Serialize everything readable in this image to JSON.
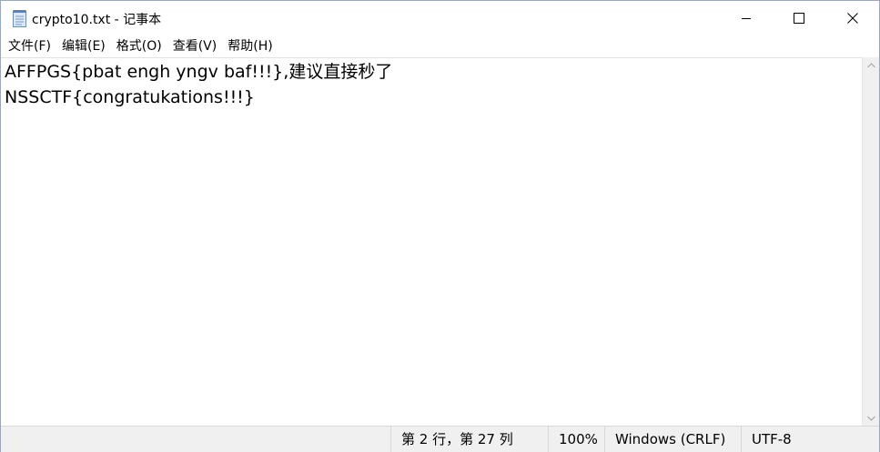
{
  "window": {
    "title": "crypto10.txt - 记事本"
  },
  "menu": {
    "items": [
      {
        "label": "文件(F)"
      },
      {
        "label": "编辑(E)"
      },
      {
        "label": "格式(O)"
      },
      {
        "label": "查看(V)"
      },
      {
        "label": "帮助(H)"
      }
    ]
  },
  "editor": {
    "lines": [
      "AFFPGS{pbat engh yngv baf!!!},建议直接秒了",
      "NSSCTF{congratukations!!!}"
    ]
  },
  "status": {
    "position": "第 2 行，第 27 列",
    "zoom": "100%",
    "line_ending": "Windows (CRLF)",
    "encoding": "UTF-8"
  },
  "icons": {
    "app": "notepad-icon",
    "minimize": "minimize-icon",
    "maximize": "maximize-icon",
    "close": "close-icon",
    "scroll_up": "chevron-up-icon",
    "scroll_down": "chevron-down-icon"
  },
  "colors": {
    "text": "#000000",
    "statusbar_bg": "#f0f0f0",
    "scrollbar_bg": "#f0f0f0"
  }
}
